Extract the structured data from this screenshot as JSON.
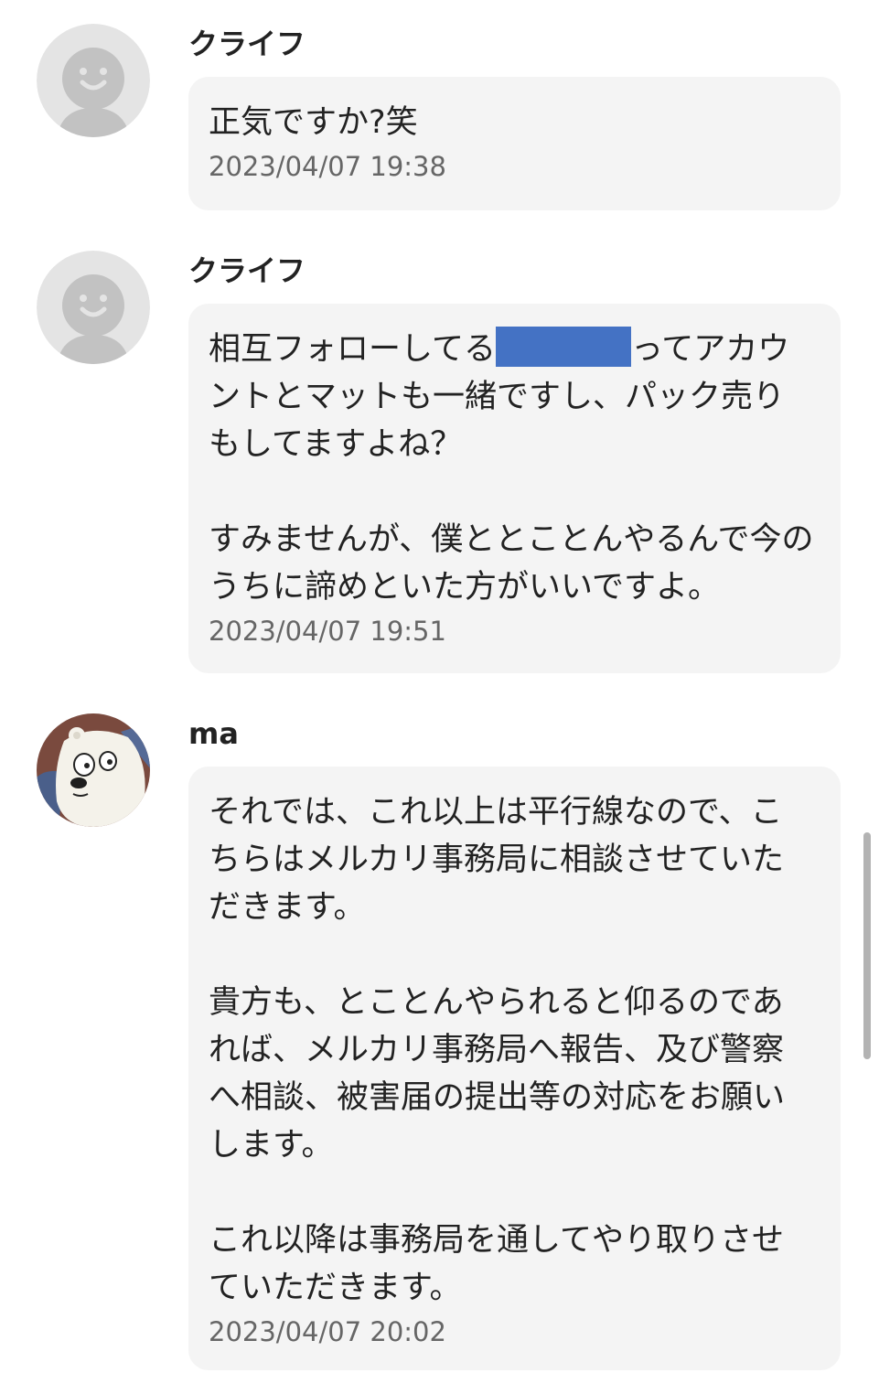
{
  "messages": [
    {
      "sender": "クライフ",
      "avatar": "default-user-icon",
      "lines": [
        "正気ですか?笑"
      ],
      "time": "2023/04/07 19:38"
    },
    {
      "sender": "クライフ",
      "avatar": "default-user-icon",
      "line1_before": "相互フォローしてる",
      "line1_after": "ってアカウ",
      "lines": [
        "ントとマットも一緒ですし、パック売り",
        "もしてますよね？",
        "",
        "すみませんが、僕ととことんやるんで今の",
        "うちに諦めといた方がいいですよ。"
      ],
      "time": "2023/04/07 19:51"
    },
    {
      "sender": "ma",
      "avatar": "polar-bear-avatar",
      "lines": [
        "それでは、これ以上は平行線なので、こ",
        "ちらはメルカリ事務局に相談させていた",
        "だきます。",
        "",
        "貴方も、とことんやられると仰るのであ",
        "れば、メルカリ事務局へ報告、及び警察",
        "へ相談、被害届の提出等の対応をお願い",
        "します。",
        "",
        "これ以降は事務局を通してやり取りさせ",
        "ていただきます。"
      ],
      "time": "2023/04/07 20:02"
    }
  ],
  "colors": {
    "bubble": "#f4f4f4",
    "redaction": "#4472c4",
    "timestamp": "#666666",
    "default_avatar_bg": "#e4e4e4",
    "default_avatar_fg": "#c2c2c2"
  }
}
